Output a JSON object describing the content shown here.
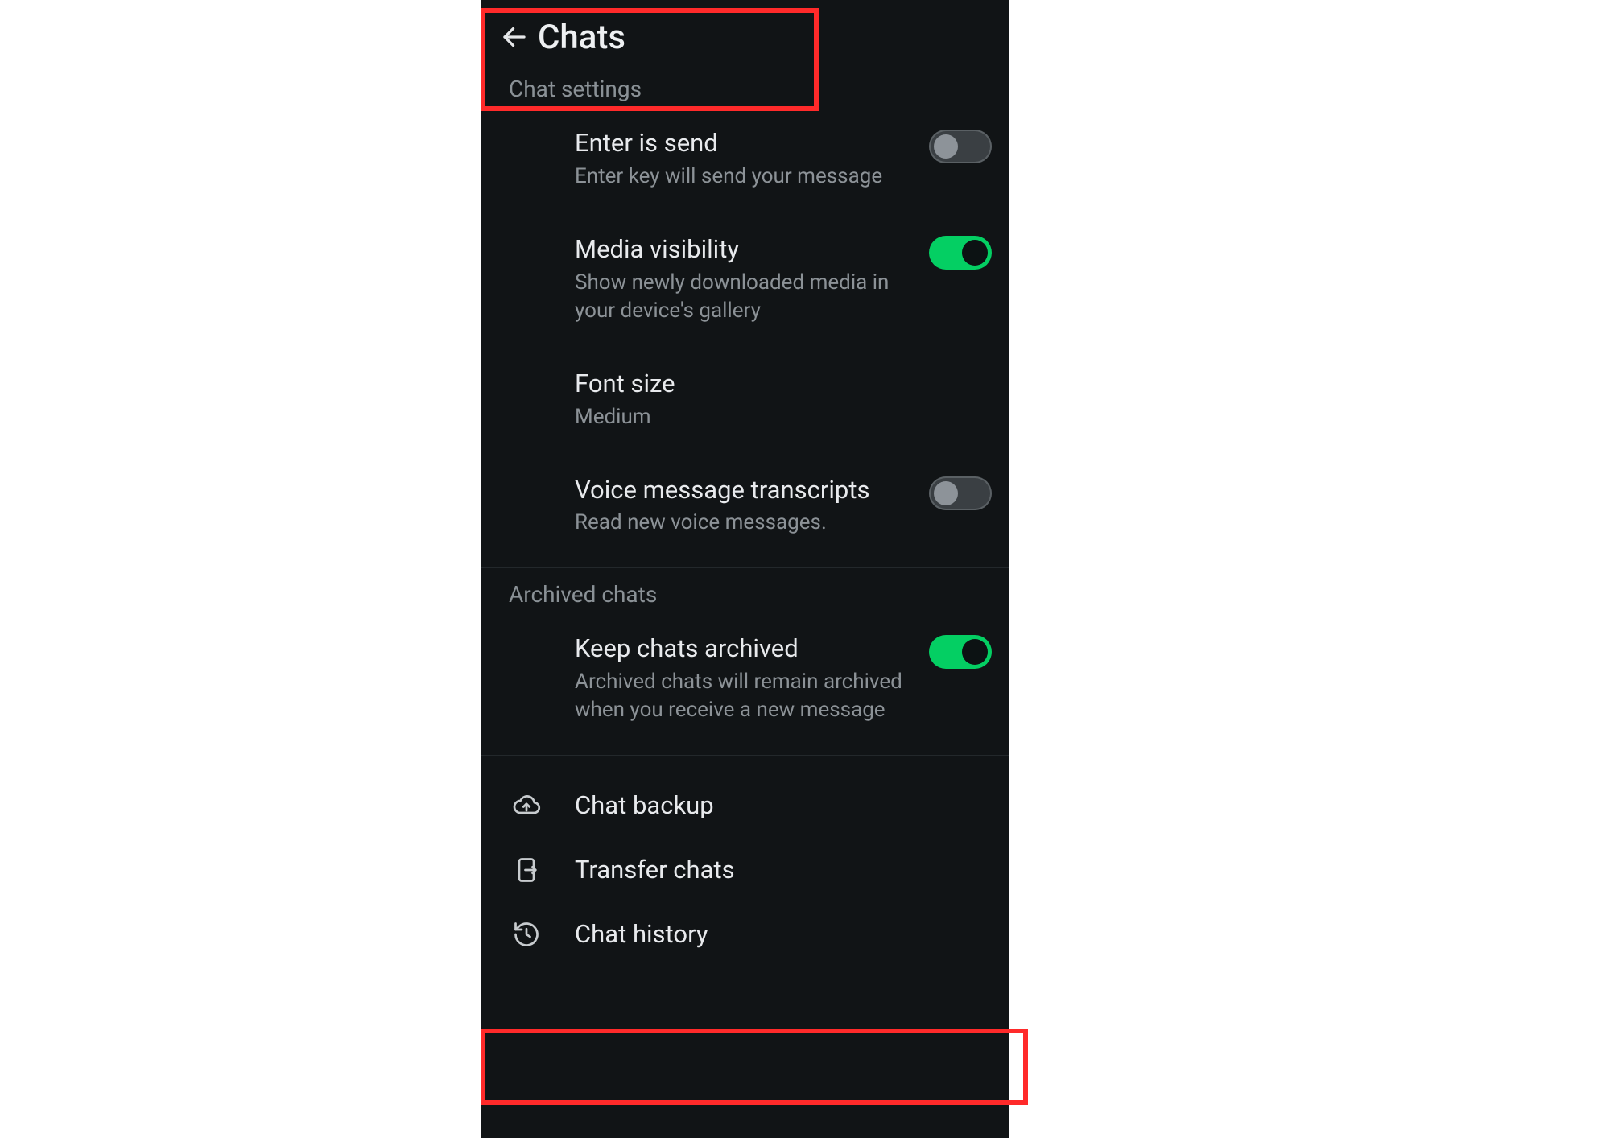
{
  "header": {
    "title": "Chats"
  },
  "sections": {
    "chat_settings": {
      "heading": "Chat settings",
      "enter_is_send": {
        "title": "Enter is send",
        "sub": "Enter key will send your message",
        "on": false
      },
      "media_visibility": {
        "title": "Media visibility",
        "sub": "Show newly downloaded media in your device's gallery",
        "on": true
      },
      "font_size": {
        "title": "Font size",
        "sub": "Medium"
      },
      "voice_transcripts": {
        "title": "Voice message transcripts",
        "sub": "Read new voice messages.",
        "on": false
      }
    },
    "archived": {
      "heading": "Archived chats",
      "keep_archived": {
        "title": "Keep chats archived",
        "sub": "Archived chats will remain archived when you receive a new message",
        "on": true
      }
    },
    "actions": {
      "chat_backup": "Chat backup",
      "transfer_chats": "Transfer chats",
      "chat_history": "Chat history"
    }
  },
  "highlights": {
    "top": "header-chats",
    "bottom": "chat-history-row"
  }
}
